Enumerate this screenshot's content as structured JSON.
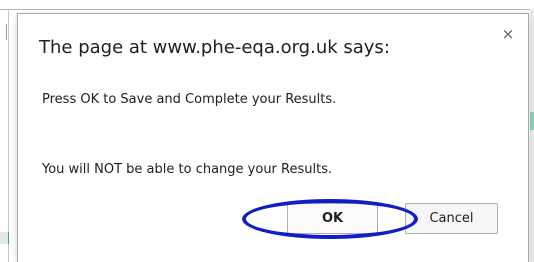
{
  "dialog": {
    "title": "The page at www.phe-eqa.org.uk says:",
    "message_line1": "Press OK to Save and Complete your Results.",
    "message_line2": "You will NOT be able to change your Results.",
    "close_label": "×"
  },
  "buttons": {
    "ok_label": "OK",
    "cancel_label": "Cancel"
  },
  "colors": {
    "highlight": "#0e1ec8"
  },
  "icons": {
    "close": "close-icon"
  }
}
